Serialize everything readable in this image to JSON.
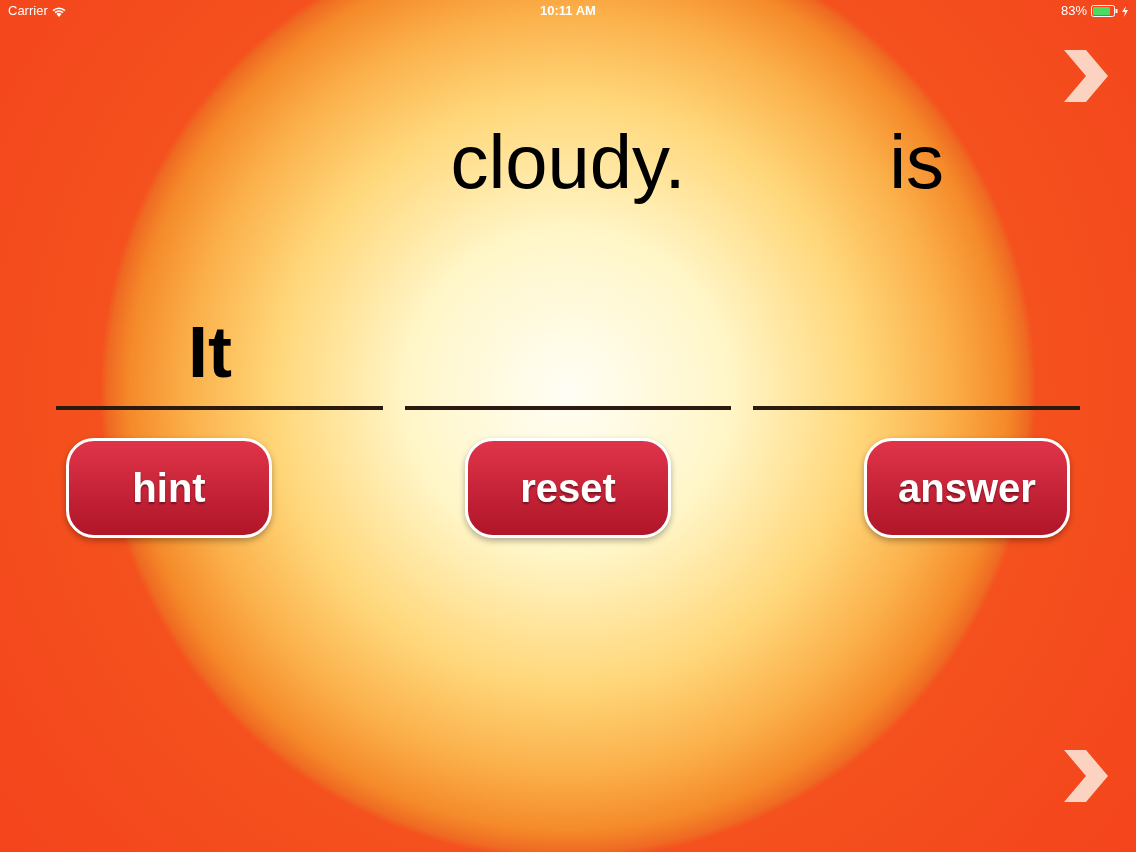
{
  "status_bar": {
    "carrier": "Carrier",
    "time": "10:11 AM",
    "battery": "83%"
  },
  "word_bank": [
    {
      "text": "cloudy."
    },
    {
      "text": "is"
    }
  ],
  "placed_words": [
    "It"
  ],
  "buttons": [
    "hint",
    "reset",
    "answer"
  ]
}
